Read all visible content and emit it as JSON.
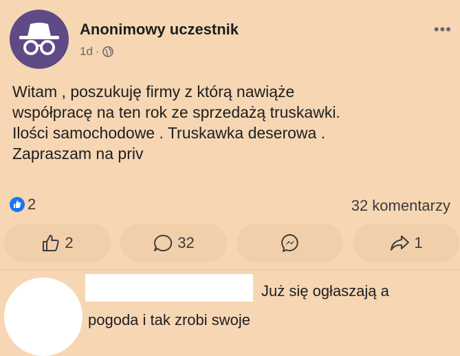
{
  "post": {
    "author": "Anonimowy uczestnik",
    "time": "1d",
    "separator": "·",
    "avatar_icon": "incognito-icon",
    "privacy_icon": "globe-icon",
    "more": "•••",
    "text_lines": [
      "Witam , poszukuję firmy z którą nawiąże",
      "współpracę na ten rok ze sprzedażą truskawki.",
      "Ilości samochodowe . Truskawka deserowa .",
      "Zapraszam na priv"
    ]
  },
  "stats": {
    "reaction_count": "2",
    "reaction_icon": "like-badge-icon",
    "comments": "32 komentarzy"
  },
  "actions": {
    "like_count": "2",
    "comment_count": "32",
    "messenger_icon": "messenger-icon",
    "share_count": "1"
  },
  "comment": {
    "line1": "Już się ogłaszają a",
    "line2": "pogoda i tak zrobi swoje"
  },
  "colors": {
    "background": "#f7d6b3",
    "button_bg": "#f2cfab",
    "avatar_bg": "#5e4a87",
    "like_blue": "#1877f2"
  }
}
